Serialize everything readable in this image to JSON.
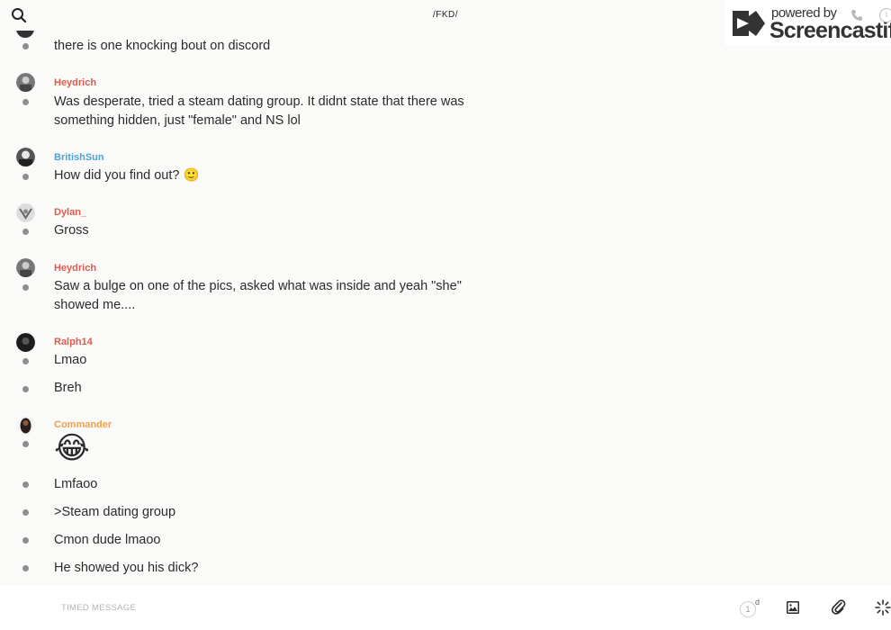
{
  "header": {
    "room_title": "/FKD/",
    "search_icon": "search-icon"
  },
  "watermark": {
    "powered": "powered by",
    "name": "Screencastify"
  },
  "messages": [
    {
      "type": "continuation",
      "text": "there is one knocking bout on discord"
    },
    {
      "user": "Heydrich",
      "user_color": "#e05a4f",
      "text": "Was desperate, tried a steam dating group. It didnt state that there was something hidden, just \"female\" and NS lol"
    },
    {
      "user": "BritishSun",
      "user_color": "#4aa3df",
      "text": "How did you find out? 🙂"
    },
    {
      "user": "Dylan_",
      "user_color": "#e05a4f",
      "text": "Gross"
    },
    {
      "user": "Heydrich",
      "user_color": "#e05a4f",
      "text": "Saw a bulge on one of the pics, asked what was inside and yeah \"she\" showed me...."
    },
    {
      "user": "Ralph14",
      "user_color": "#e05a4f",
      "text": "Lmao"
    },
    {
      "type": "continuation",
      "text": "Breh"
    },
    {
      "user": "Commander",
      "user_color": "#f0a04b",
      "text": "😂"
    },
    {
      "type": "continuation",
      "text": "Lmfaoo"
    },
    {
      "type": "continuation",
      "text": ">Steam dating group"
    },
    {
      "type": "continuation",
      "text": "Cmon dude lmaoo"
    },
    {
      "type": "continuation",
      "text": "He showed you his dick?"
    }
  ],
  "composer": {
    "placeholder": "TIMED MESSAGE",
    "timer_value": "1",
    "timer_unit": "d"
  },
  "colors": {
    "background": "#fafaf8",
    "red_user": "#e05a4f",
    "blue_user": "#4aa3df",
    "orange_user": "#f0a04b"
  }
}
